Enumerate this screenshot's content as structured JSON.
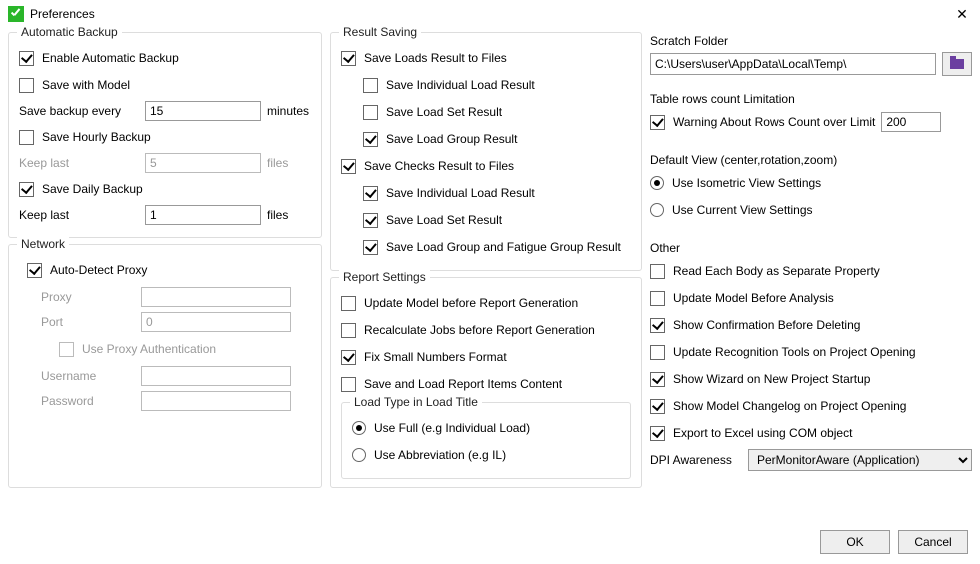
{
  "window": {
    "title": "Preferences"
  },
  "backup": {
    "title": "Automatic Backup",
    "enable": "Enable Automatic Backup",
    "saveWithModel": "Save with Model",
    "saveEvery": "Save backup every",
    "saveEveryValue": "15",
    "minutes": "minutes",
    "hourly": "Save Hourly Backup",
    "keepLast": "Keep last",
    "hourlyKeep": "5",
    "files": "files",
    "daily": "Save Daily Backup",
    "dailyKeep": "1"
  },
  "network": {
    "title": "Network",
    "auto": "Auto-Detect Proxy",
    "proxy": "Proxy",
    "port": "Port",
    "portValue": "0",
    "useAuth": "Use Proxy Authentication",
    "user": "Username",
    "pass": "Password"
  },
  "result": {
    "title": "Result Saving",
    "saveLoads": "Save Loads Result to Files",
    "indivLoad": "Save Individual Load Result",
    "loadSet": "Save Load Set Result",
    "loadGroup": "Save Load Group Result",
    "saveChecks": "Save Checks Result to Files",
    "indivLoad2": "Save Individual Load Result",
    "loadSet2": "Save Load Set Result",
    "loadGroupFatigue": "Save Load Group and Fatigue Group Result"
  },
  "report": {
    "title": "Report Settings",
    "updateModel": "Update Model before Report Generation",
    "recalc": "Recalculate Jobs before Report Generation",
    "fixSmall": "Fix Small Numbers Format",
    "saveLoadItems": "Save and Load Report Items Content",
    "loadTypeTitle": "Load Type in Load Title",
    "useFull": "Use Full (e.g Individual Load)",
    "useAbbr": "Use Abbreviation (e.g IL)"
  },
  "scratch": {
    "title": "Scratch Folder",
    "path": "C:\\Users\\user\\AppData\\Local\\Temp\\"
  },
  "tableLimit": {
    "title": "Table rows count Limitation",
    "warn": "Warning About Rows Count over Limit",
    "value": "200"
  },
  "defaultView": {
    "title": "Default View (center,rotation,zoom)",
    "iso": "Use Isometric View Settings",
    "current": "Use Current View Settings"
  },
  "other": {
    "title": "Other",
    "readBody": "Read Each Body as Separate Property",
    "updateBefore": "Update Model Before Analysis",
    "confirmDelete": "Show Confirmation Before Deleting",
    "updateRecog": "Update Recognition Tools on Project Opening",
    "wizard": "Show Wizard on New Project Startup",
    "changelog": "Show Model Changelog on Project Opening",
    "exportExcel": "Export to Excel using COM object",
    "dpiLabel": "DPI Awareness",
    "dpiValue": "PerMonitorAware (Application)"
  },
  "footer": {
    "ok": "OK",
    "cancel": "Cancel"
  }
}
